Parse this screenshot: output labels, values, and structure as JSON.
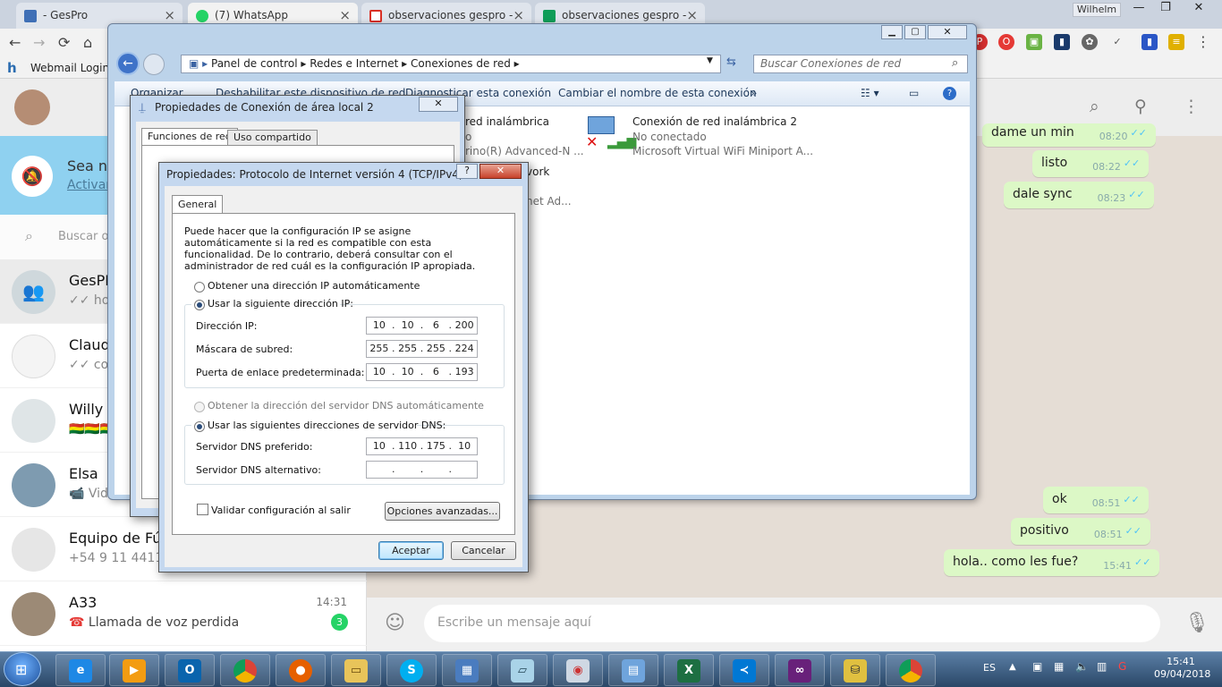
{
  "browser": {
    "tabs": [
      {
        "label": "- GesPro",
        "favicon_color": "#3f6fb6"
      },
      {
        "label": "(7) WhatsApp",
        "favicon_color": "#25d366"
      },
      {
        "label": "observaciones gespro - ",
        "favicon_color": "#d93025"
      },
      {
        "label": "observaciones gespro - ",
        "favicon_color": "#0f9d58"
      }
    ],
    "profile": "Wilhelm",
    "bookmark": "Webmail Login"
  },
  "whatsapp": {
    "notify": {
      "title": "Sea no",
      "link": "Activar"
    },
    "search_placeholder": "Buscar o",
    "chats": [
      {
        "name": "GesPR",
        "preview": "✓✓ hola",
        "time": "",
        "avatar_color": "#cfd8dc"
      },
      {
        "name": "Claudi",
        "preview": "✓✓ com",
        "time": "",
        "avatar_color": "#f4f4f4"
      },
      {
        "name": "Willy",
        "preview": "🇧🇴🇧🇴🇧🇴",
        "time": "",
        "avatar_color": "#dfe5e7"
      },
      {
        "name": "Elsa",
        "preview": "📹 Vide",
        "time": "",
        "avatar_color": "#7e9bb0"
      },
      {
        "name": "Equipo de Fút",
        "preview": "+54 9 11 4411-6",
        "time": "",
        "avatar_color": "#e6e6e6"
      },
      {
        "name": "A33",
        "preview": "Llamada de voz perdida",
        "time": "14:31",
        "avatar_color": "#9c8a76",
        "unread": "3"
      }
    ],
    "messages_top": [
      {
        "text": "dame un min",
        "time": "08:20"
      },
      {
        "text": "listo",
        "time": "08:22"
      },
      {
        "text": "dale sync",
        "time": "08:23"
      }
    ],
    "messages_bottom": [
      {
        "text": "ok",
        "time": "08:51"
      },
      {
        "text": "positivo",
        "time": "08:51"
      },
      {
        "text": "hola.. como les fue?",
        "time": "15:41"
      }
    ],
    "composer_placeholder": "Escribe un mensaje aquí"
  },
  "explorer": {
    "breadcrumb": [
      "Panel de control",
      "Redes e Internet",
      "Conexiones de red"
    ],
    "search_placeholder": "Buscar Conexiones de red",
    "commands": [
      "Organizar",
      "Deshabilitar este dispositivo de red",
      "Diagnosticar esta conexión",
      "Cambiar el nombre de esta conexión"
    ],
    "connections": [
      {
        "name": "red inalámbrica",
        "status": "o",
        "device": "rino(R) Advanced-N ..."
      },
      {
        "name": "Conexión de red inalámbrica 2",
        "status": "No conectado",
        "device": "Microsoft Virtual WiFi Miniport A..."
      },
      {
        "name": "vork",
        "status": "",
        "device": "net Ad..."
      }
    ]
  },
  "props_local": {
    "title": "Propiedades de Conexión de área local 2",
    "tabs": [
      "Funciones de red",
      "Uso compartido"
    ]
  },
  "ipv4": {
    "title": "Propiedades: Protocolo de Internet versión 4 (TCP/IPv4)",
    "help": "?",
    "tab": "General",
    "description": "Puede hacer que la configuración IP se asigne automáticamente si la red es compatible con esta funcionalidad. De lo contrario, deberá consultar con el administrador de red cuál es la configuración IP apropiada.",
    "auto_ip": "Obtener una dirección IP automáticamente",
    "manual_ip": "Usar la siguiente dirección IP:",
    "ip_label": "Dirección IP:",
    "ip": [
      "10",
      "10",
      "6",
      "200"
    ],
    "mask_label": "Máscara de subred:",
    "mask": [
      "255",
      "255",
      "255",
      "224"
    ],
    "gw_label": "Puerta de enlace predeterminada:",
    "gw": [
      "10",
      "10",
      "6",
      "193"
    ],
    "auto_dns": "Obtener la dirección del servidor DNS automáticamente",
    "manual_dns": "Usar las siguientes direcciones de servidor DNS:",
    "dns1_label": "Servidor DNS preferido:",
    "dns1": [
      "10",
      "110",
      "175",
      "10"
    ],
    "dns2_label": "Servidor DNS alternativo:",
    "dns2": [
      "",
      "",
      "",
      ""
    ],
    "validate": "Validar configuración al salir",
    "advanced": "Opciones avanzadas...",
    "ok": "Aceptar",
    "cancel": "Cancelar"
  },
  "taskbar": {
    "lang": "ES",
    "time": "15:41",
    "date": "09/04/2018"
  }
}
